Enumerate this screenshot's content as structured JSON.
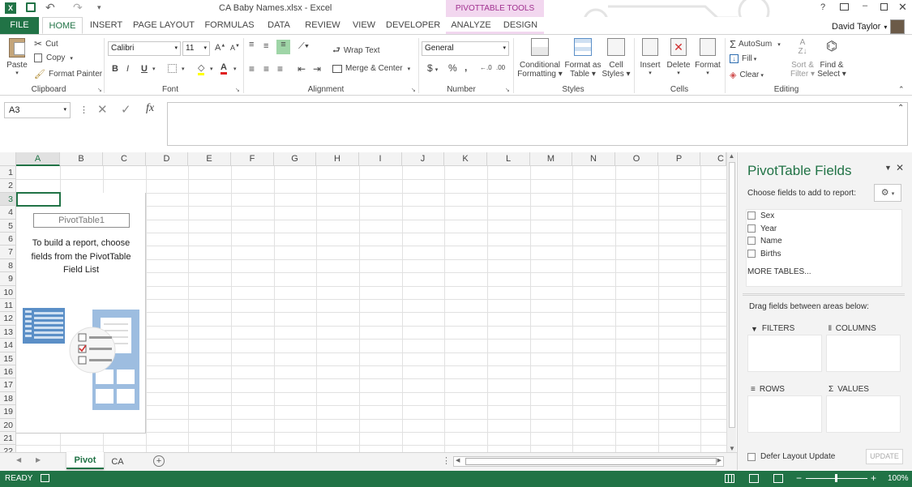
{
  "window": {
    "title": "CA Baby Names.xlsx - Excel",
    "user": "David Taylor",
    "context_tools": "PIVOTTABLE TOOLS"
  },
  "tabs": [
    "FILE",
    "HOME",
    "INSERT",
    "PAGE LAYOUT",
    "FORMULAS",
    "DATA",
    "REVIEW",
    "VIEW",
    "DEVELOPER",
    "ANALYZE",
    "DESIGN"
  ],
  "ribbon": {
    "clipboard": {
      "paste": "Paste",
      "cut": "Cut",
      "copy": "Copy",
      "format_painter": "Format Painter",
      "label": "Clipboard"
    },
    "font": {
      "name": "Calibri",
      "size": "11",
      "bold": "B",
      "italic": "I",
      "underline": "U",
      "label": "Font"
    },
    "alignment": {
      "wrap": "Wrap Text",
      "merge": "Merge & Center",
      "label": "Alignment"
    },
    "number": {
      "format": "General",
      "currency": "$",
      "percent": "%",
      "comma": ",",
      "label": "Number"
    },
    "styles": {
      "cond": "Conditional",
      "cond2": "Formatting",
      "fmt_table": "Format as",
      "fmt_table2": "Table",
      "cell": "Cell",
      "cell2": "Styles",
      "label": "Styles"
    },
    "cells": {
      "insert": "Insert",
      "delete": "Delete",
      "format": "Format",
      "label": "Cells"
    },
    "editing": {
      "autosum": "AutoSum",
      "fill": "Fill",
      "clear": "Clear",
      "sort": "Sort &",
      "sort2": "Filter",
      "find": "Find &",
      "find2": "Select",
      "label": "Editing"
    }
  },
  "formula_bar": {
    "name_box": "A3",
    "formula": ""
  },
  "columns": [
    "A",
    "B",
    "C",
    "D",
    "E",
    "F",
    "G",
    "H",
    "I",
    "J",
    "K",
    "L",
    "M",
    "N",
    "O",
    "P",
    "C"
  ],
  "rows": [
    "1",
    "2",
    "3",
    "4",
    "5",
    "6",
    "7",
    "8",
    "9",
    "10",
    "11",
    "12",
    "13",
    "14",
    "15",
    "16",
    "17",
    "18",
    "19",
    "20",
    "21",
    "22"
  ],
  "pivot": {
    "name": "PivotTable1",
    "message": "To build a report, choose fields from the PivotTable Field List"
  },
  "pane": {
    "title": "PivotTable Fields",
    "choose": "Choose fields to add to report:",
    "fields": [
      "Sex",
      "Year",
      "Name",
      "Births"
    ],
    "more": "MORE TABLES...",
    "drag": "Drag fields between areas below:",
    "areas": {
      "filters": "FILTERS",
      "columns": "COLUMNS",
      "rows": "ROWS",
      "values": "VALUES"
    },
    "defer": "Defer Layout Update",
    "update": "UPDATE"
  },
  "sheets": [
    "Pivot",
    "CA"
  ],
  "status": {
    "mode": "READY",
    "zoom": "100%"
  }
}
